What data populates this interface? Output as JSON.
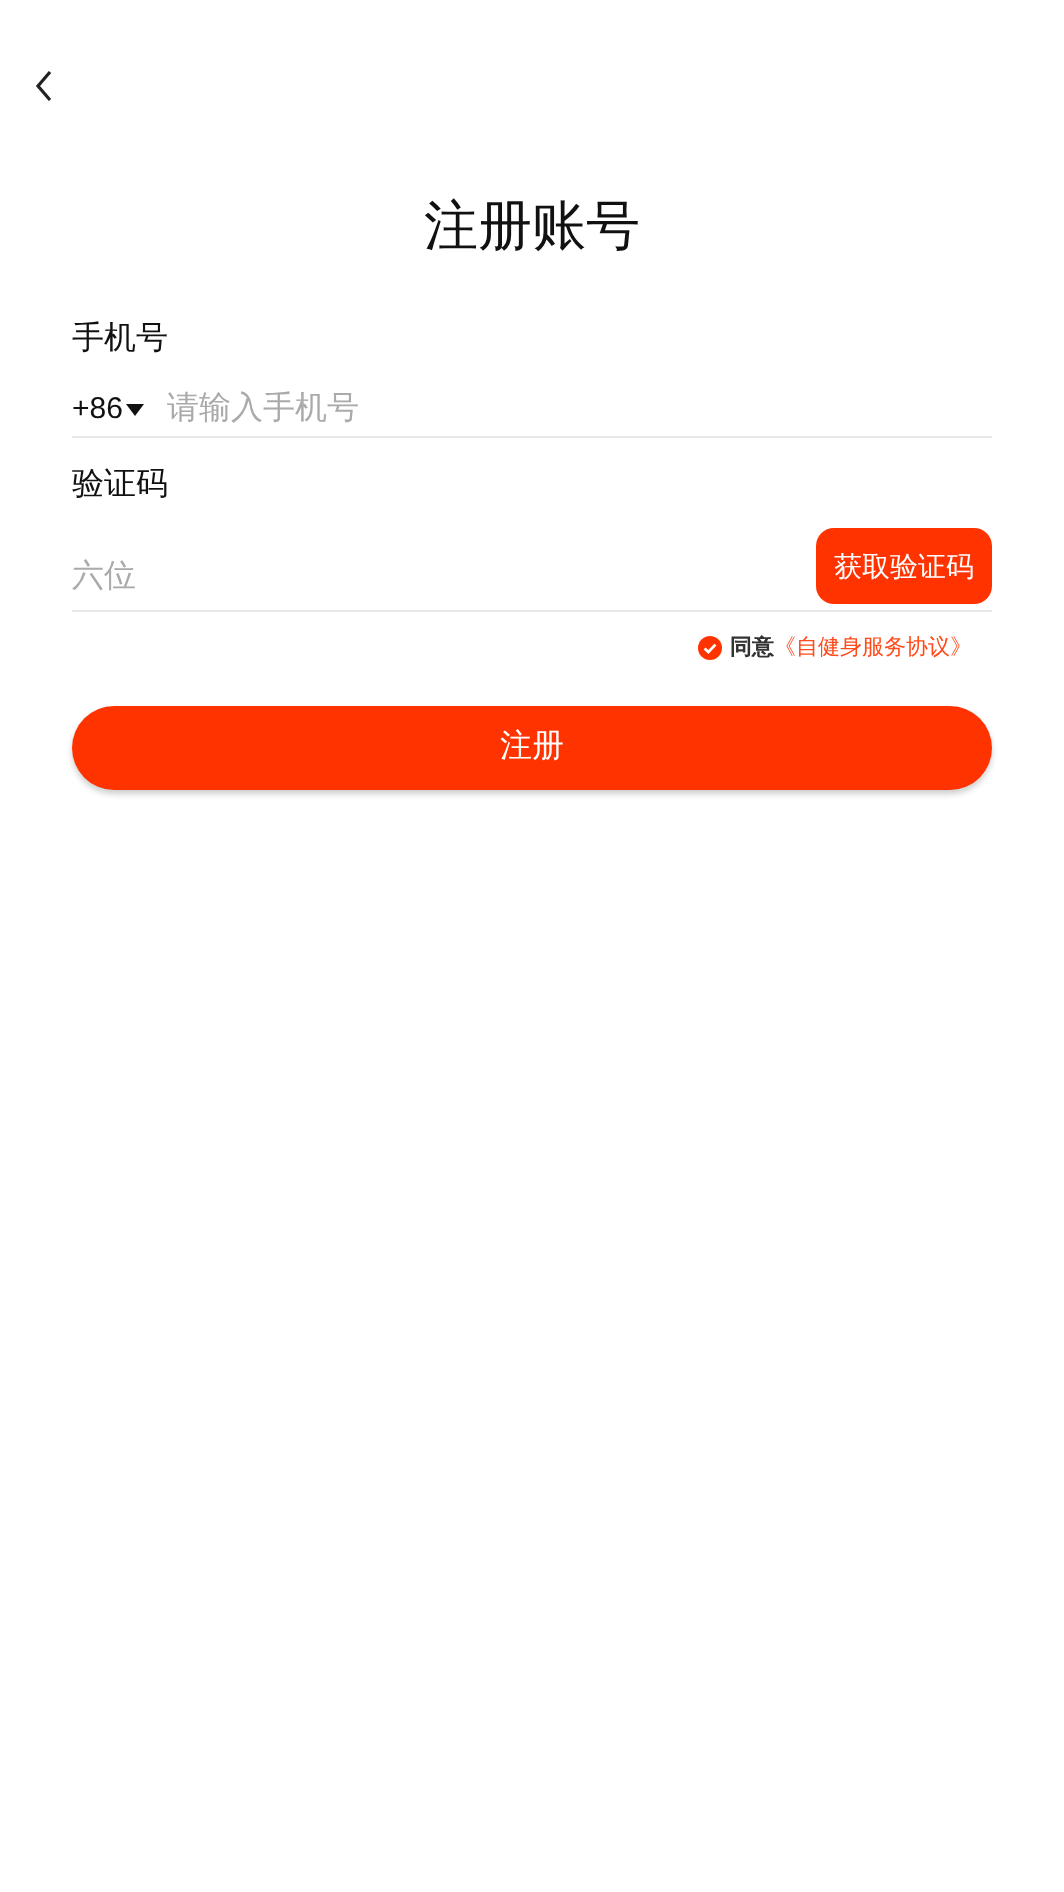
{
  "title": "注册账号",
  "phone": {
    "label": "手机号",
    "country_code": "+86",
    "placeholder": "请输入手机号"
  },
  "code": {
    "label": "验证码",
    "placeholder": "六位",
    "button": "获取验证码"
  },
  "agreement": {
    "checked": true,
    "text": "同意",
    "link": "《自健身服务协议》"
  },
  "submit": "注册"
}
